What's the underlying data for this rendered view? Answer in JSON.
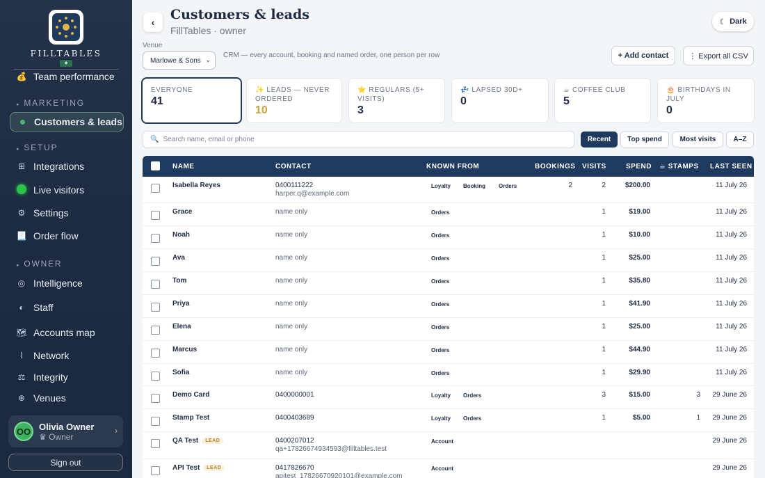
{
  "brand": {
    "name": "FILLTABLES",
    "mark": "◆"
  },
  "sidebar": {
    "top_item": {
      "label": "Team performance",
      "icon": "💰"
    },
    "sections": [
      {
        "title": "MARKETING",
        "items": [
          {
            "label": "Customers & leads",
            "icon": "dot-icon",
            "active": true
          }
        ]
      },
      {
        "title": "SETUP",
        "items": [
          {
            "label": "Integrations",
            "icon": "⊞"
          },
          {
            "label": "Live visitors",
            "icon": "live-dot-icon"
          },
          {
            "label": "Settings",
            "icon": "⚙"
          },
          {
            "label": "Order flow",
            "icon": "📃"
          }
        ]
      },
      {
        "title": "OWNER",
        "items": [
          {
            "label": "Intelligence",
            "icon": "◎"
          },
          {
            "label": "Staff",
            "icon": "◐"
          },
          {
            "label": "Accounts map",
            "icon": "🗺"
          },
          {
            "label": "Network",
            "icon": "⌇"
          },
          {
            "label": "Integrity",
            "icon": "⚖"
          },
          {
            "label": "Venues",
            "icon": "⊕"
          }
        ]
      }
    ],
    "user": {
      "initials": "OO",
      "name": "Olivia Owner",
      "role": "♛ Owner",
      "chevron": "›"
    },
    "signout_label": "Sign out"
  },
  "header": {
    "back": "‹",
    "title": "Customers & leads",
    "subtitle": "FillTables · owner",
    "dark_label": "Dark",
    "dark_icon": "☾"
  },
  "venue": {
    "label": "Venue",
    "selected": "Marlowe & Sons",
    "chevron": "⌄"
  },
  "description": "CRM — every account, booking and named order, one person per row",
  "actions": {
    "add": "+ Add contact",
    "export": "⋮ Export all CSV"
  },
  "stats": [
    {
      "label": "EVERYONE",
      "value": "41",
      "selected": true
    },
    {
      "label": "✨ LEADS — NEVER ORDERED",
      "value": "10",
      "gold": true
    },
    {
      "label": "⭐ REGULARS (5+ VISITS)",
      "value": "3"
    },
    {
      "label": "💤 LAPSED 30D+",
      "value": "0"
    },
    {
      "label": "☕ COFFEE CLUB",
      "value": "5"
    },
    {
      "label": "🎂 BIRTHDAYS IN JULY",
      "value": "0"
    }
  ],
  "search": {
    "placeholder": "Search name, email or phone",
    "icon": "🔍"
  },
  "filters": [
    {
      "label": "Recent",
      "active": true
    },
    {
      "label": "Top spend"
    },
    {
      "label": "Most visits"
    },
    {
      "label": "A–Z"
    }
  ],
  "table": {
    "columns": {
      "name": "NAME",
      "contact": "CONTACT",
      "known_from": "KNOWN FROM",
      "bookings": "BOOKINGS",
      "visits": "VISITS",
      "spend": "SPEND",
      "stamps": "☕ STAMPS",
      "last_seen": "LAST SEEN"
    },
    "rows": [
      {
        "name": "Isabella Reyes",
        "contact1": "0400111222",
        "contact2": "harper.q@example.com",
        "tags": [
          "Loyalty",
          "Booking",
          "Orders"
        ],
        "bookings": "2",
        "visits": "2",
        "spend": "$200.00",
        "stamps": "",
        "last_seen": "11 July 26",
        "lead": false
      },
      {
        "name": "Grace",
        "contact1": "name only",
        "contact2": "",
        "tags": [
          "Orders"
        ],
        "bookings": "",
        "visits": "1",
        "spend": "$19.00",
        "stamps": "",
        "last_seen": "11 July 26",
        "lead": false
      },
      {
        "name": "Noah",
        "contact1": "name only",
        "contact2": "",
        "tags": [
          "Orders"
        ],
        "bookings": "",
        "visits": "1",
        "spend": "$10.00",
        "stamps": "",
        "last_seen": "11 July 26",
        "lead": false
      },
      {
        "name": "Ava",
        "contact1": "name only",
        "contact2": "",
        "tags": [
          "Orders"
        ],
        "bookings": "",
        "visits": "1",
        "spend": "$25.00",
        "stamps": "",
        "last_seen": "11 July 26",
        "lead": false
      },
      {
        "name": "Tom",
        "contact1": "name only",
        "contact2": "",
        "tags": [
          "Orders"
        ],
        "bookings": "",
        "visits": "1",
        "spend": "$35.80",
        "stamps": "",
        "last_seen": "11 July 26",
        "lead": false
      },
      {
        "name": "Priya",
        "contact1": "name only",
        "contact2": "",
        "tags": [
          "Orders"
        ],
        "bookings": "",
        "visits": "1",
        "spend": "$41.90",
        "stamps": "",
        "last_seen": "11 July 26",
        "lead": false
      },
      {
        "name": "Elena",
        "contact1": "name only",
        "contact2": "",
        "tags": [
          "Orders"
        ],
        "bookings": "",
        "visits": "1",
        "spend": "$25.00",
        "stamps": "",
        "last_seen": "11 July 26",
        "lead": false
      },
      {
        "name": "Marcus",
        "contact1": "name only",
        "contact2": "",
        "tags": [
          "Orders"
        ],
        "bookings": "",
        "visits": "1",
        "spend": "$44.90",
        "stamps": "",
        "last_seen": "11 July 26",
        "lead": false
      },
      {
        "name": "Sofia",
        "contact1": "name only",
        "contact2": "",
        "tags": [
          "Orders"
        ],
        "bookings": "",
        "visits": "1",
        "spend": "$29.90",
        "stamps": "",
        "last_seen": "11 July 26",
        "lead": false
      },
      {
        "name": "Demo Card",
        "contact1": "0400000001",
        "contact2": "",
        "tags": [
          "Loyalty",
          "Orders"
        ],
        "bookings": "",
        "visits": "3",
        "spend": "$15.00",
        "stamps": "3",
        "last_seen": "29 June 26",
        "lead": false
      },
      {
        "name": "Stamp Test",
        "contact1": "0400403689",
        "contact2": "",
        "tags": [
          "Loyalty",
          "Orders"
        ],
        "bookings": "",
        "visits": "1",
        "spend": "$5.00",
        "stamps": "1",
        "last_seen": "29 June 26",
        "lead": false
      },
      {
        "name": "QA Test",
        "contact1": "0400207012",
        "contact2": "qa+17826674934593@filltables.test",
        "tags": [
          "Account"
        ],
        "bookings": "",
        "visits": "",
        "spend": "",
        "stamps": "",
        "last_seen": "29 June 26",
        "lead": true
      },
      {
        "name": "API Test",
        "contact1": "0417826670",
        "contact2": "apitest_17826670920101@example.com",
        "tags": [
          "Account"
        ],
        "bookings": "",
        "visits": "",
        "spend": "",
        "stamps": "",
        "last_seen": "29 June 26",
        "lead": true
      }
    ],
    "lead_badge": "LEAD"
  }
}
